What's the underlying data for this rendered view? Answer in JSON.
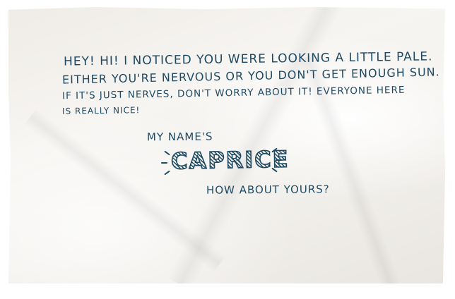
{
  "note": {
    "lines": [
      "HEY! HI! I NOTICED YOU WERE LOOKING A LITTLE PALE.",
      "EITHER YOU'RE NERVOUS OR YOU DON'T GET ENOUGH SUN.",
      "IF IT'S JUST NERVES, DON'T WORRY ABOUT IT! EVERYONE HERE",
      "IS REALLY NICE!"
    ],
    "intro": "MY NAME'S",
    "name": "CAPRICE",
    "question": "HOW ABOUT YOURS?"
  },
  "colors": {
    "ink": "#1e4a63",
    "paper": "#f4f2ee",
    "background": "#ffffff"
  }
}
